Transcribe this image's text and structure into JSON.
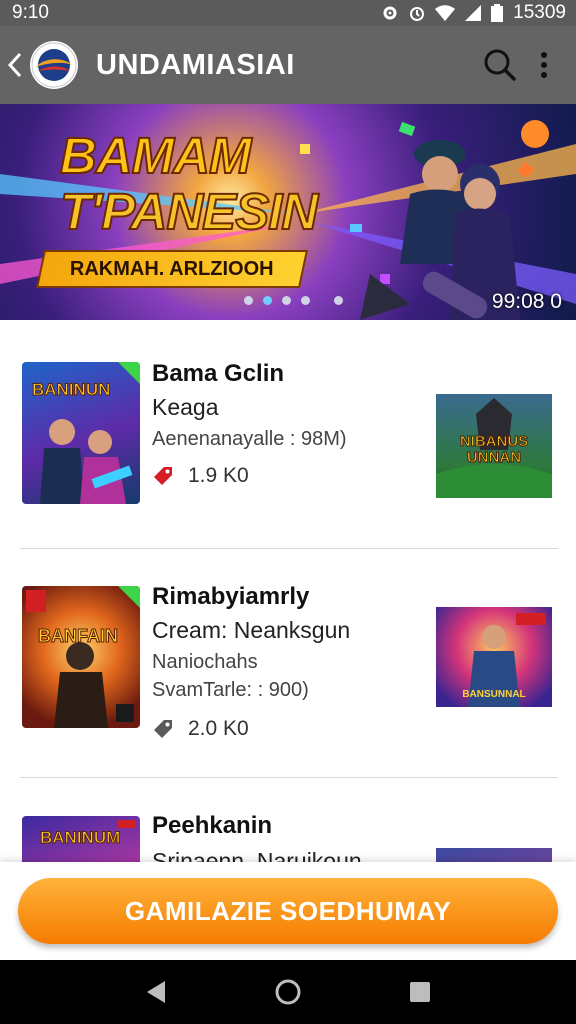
{
  "status_bar": {
    "time": "9:10",
    "right_text": "15309"
  },
  "app_bar": {
    "title": "UNDAMIASIAI"
  },
  "hero": {
    "title_line1": "BAMAM",
    "title_line2": "T'PANESIN",
    "ribbon": "RAKMAH. ARLZIOOH",
    "counter": "99:08 0",
    "dots": 5,
    "active_dot": 1
  },
  "games": [
    {
      "title": "Bama Gclin",
      "subtitle": "Keaga",
      "meta": "Aenenanayalle : 98M)",
      "extra": "",
      "count": "1.9  K0",
      "thumb_text": "BANINUN",
      "right_text": "NIBANUS\nUNNAN"
    },
    {
      "title": "Rimabyiamrly",
      "subtitle": "Cream: Neanksgun",
      "meta": "Naniochahs",
      "extra": "SvamTarle: : 900)",
      "count": "2.0  K0",
      "thumb_text": "BANFAIN",
      "right_text": "BANSUNNAL"
    },
    {
      "title": "Peehkanin",
      "subtitle": "Srinaenn. Naruikoun",
      "meta": "",
      "extra": "",
      "count": "",
      "thumb_text": "BANINUM",
      "right_text": ""
    }
  ],
  "cta": {
    "label": "GAMILAZIE SOEDHUMAY"
  },
  "colors": {
    "accent": "#f57c00",
    "app_bar": "#646464",
    "status_bar": "#5b5b5b"
  }
}
